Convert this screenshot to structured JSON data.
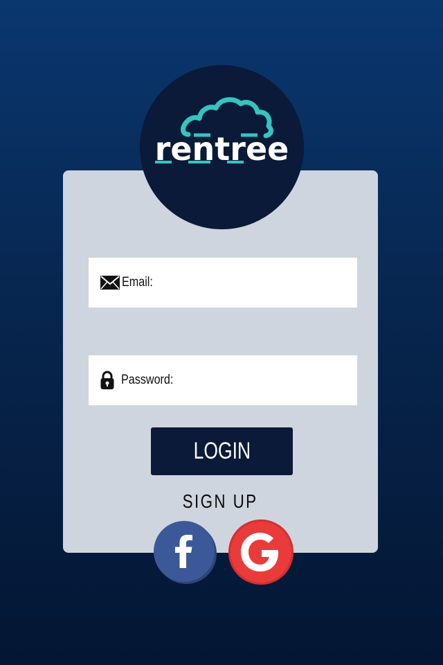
{
  "app": {
    "brand_name": "rentree"
  },
  "form": {
    "email_label": "Email:",
    "password_label": "Password:",
    "login_label": "LOGIN",
    "signup_label": "SIGN UP"
  },
  "icons": {
    "email": "envelope-icon",
    "password": "lock-icon",
    "facebook": "facebook-icon",
    "google": "google-icon",
    "logo": "cloud-icon"
  },
  "colors": {
    "background_top": "#0a376f",
    "background_bottom": "#041633",
    "card": "#cfd5de",
    "logo_circle": "#0a1a38",
    "logo_accent": "#35c4c0",
    "login_button": "#0a1a38",
    "facebook": "#3b5998",
    "google": "#e93c3a"
  }
}
